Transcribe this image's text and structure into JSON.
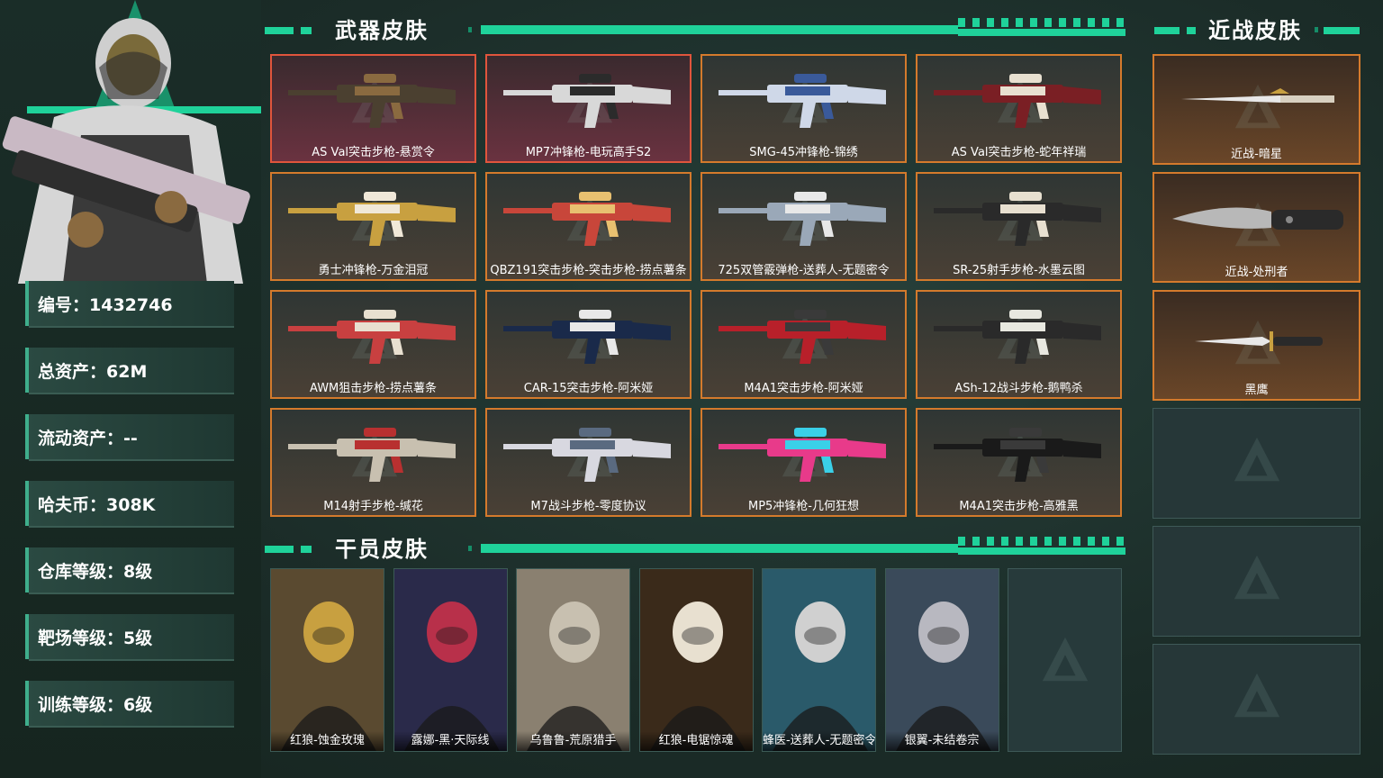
{
  "player": {
    "stats": [
      {
        "label": "编号：",
        "value": "1432746"
      },
      {
        "label": "总资产：",
        "value": "62M"
      },
      {
        "label": "流动资产：",
        "value": "--"
      },
      {
        "label": "哈夫币：",
        "value": "308K"
      },
      {
        "label": "仓库等级：",
        "value": "8级"
      },
      {
        "label": "靶场等级：",
        "value": "5级"
      },
      {
        "label": "训练等级：",
        "value": "6级"
      }
    ]
  },
  "sections": {
    "weapons": "武器皮肤",
    "operators": "干员皮肤",
    "melee": "近战皮肤"
  },
  "weapons": [
    {
      "name": "AS Val突击步枪-悬赏令",
      "rarity": "red"
    },
    {
      "name": "MP7冲锋枪-电玩高手S2",
      "rarity": "red"
    },
    {
      "name": "SMG-45冲锋枪-锦绣",
      "rarity": "gold"
    },
    {
      "name": "AS Val突击步枪-蛇年祥瑞",
      "rarity": "gold"
    },
    {
      "name": "勇士冲锋枪-万金泪冠",
      "rarity": "gold"
    },
    {
      "name": "QBZ191突击步枪-突击步枪-捞点薯条",
      "rarity": "gold"
    },
    {
      "name": "725双管霰弹枪-送葬人-无题密令",
      "rarity": "gold"
    },
    {
      "name": "SR-25射手步枪-水墨云图",
      "rarity": "gold"
    },
    {
      "name": "AWM狙击步枪-捞点薯条",
      "rarity": "gold"
    },
    {
      "name": "CAR-15突击步枪-阿米娅",
      "rarity": "gold"
    },
    {
      "name": "M4A1突击步枪-阿米娅",
      "rarity": "gold"
    },
    {
      "name": "ASh-12战斗步枪-鹅鸭杀",
      "rarity": "gold"
    },
    {
      "name": "M14射手步枪-缄花",
      "rarity": "gold"
    },
    {
      "name": "M7战斗步枪-零度协议",
      "rarity": "gold"
    },
    {
      "name": "MP5冲锋枪-几何狂想",
      "rarity": "gold"
    },
    {
      "name": "M4A1突击步枪-高雅黑",
      "rarity": "gold"
    }
  ],
  "operators": [
    {
      "name": "红狼-蚀金玫瑰"
    },
    {
      "name": "露娜-黑·天际线"
    },
    {
      "name": "乌鲁鲁-荒原猎手"
    },
    {
      "name": "红狼-电锯惊魂"
    },
    {
      "name": "蜂医-送葬人-无题密令"
    },
    {
      "name": "银翼-未结卷宗"
    },
    {
      "name": ""
    }
  ],
  "melee": [
    {
      "name": "近战-暗星"
    },
    {
      "name": "近战-处刑者"
    },
    {
      "name": "黑鹰"
    },
    {
      "name": ""
    },
    {
      "name": ""
    },
    {
      "name": ""
    }
  ],
  "colors": {
    "accent": "#1fd29a",
    "gold_border": "#d47a2c",
    "red_border": "#e0553c",
    "panel": "#2b4a42"
  }
}
